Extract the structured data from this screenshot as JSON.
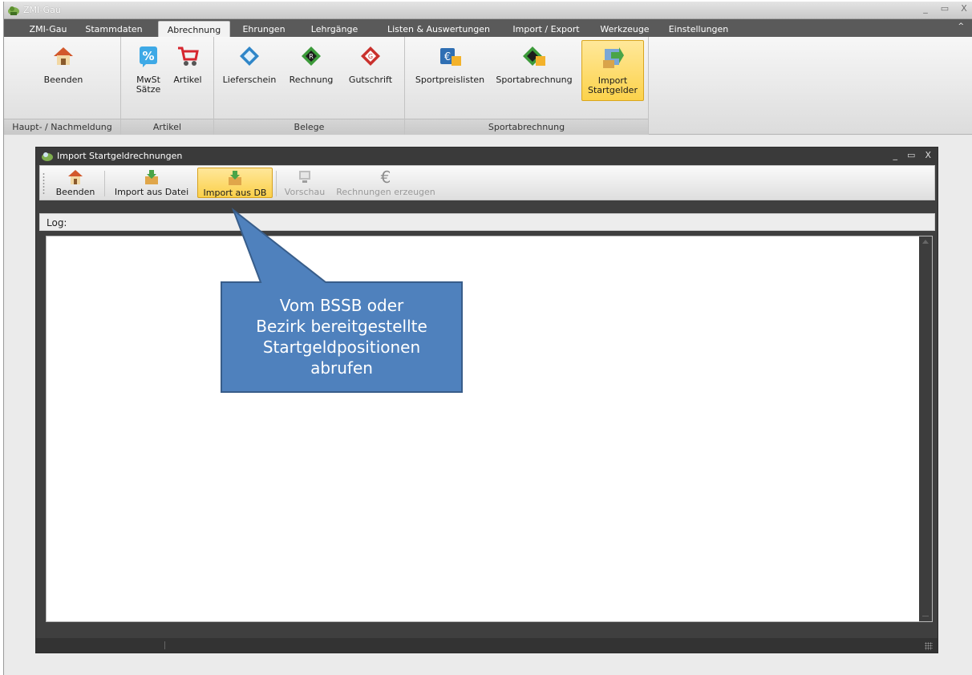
{
  "app": {
    "title": "ZMI-Gau",
    "window_controls": [
      "_",
      "▭",
      "X"
    ]
  },
  "menu": {
    "tabs": [
      {
        "label": "ZMI-Gau"
      },
      {
        "label": "Stammdaten"
      },
      {
        "label": "Abrechnung"
      },
      {
        "label": "Ehrungen"
      },
      {
        "label": "Lehrgänge"
      },
      {
        "label": "Listen & Auswertungen"
      },
      {
        "label": "Import / Export"
      },
      {
        "label": "Werkzeuge"
      },
      {
        "label": "Einstellungen"
      }
    ],
    "active_tab": "Abrechnung",
    "collapse_glyph": "^"
  },
  "ribbon": {
    "groups": [
      {
        "caption": "Haupt- / Nachmeldung",
        "buttons": [
          {
            "label": "Beenden",
            "icon": "house-icon"
          }
        ]
      },
      {
        "caption": "Artikel",
        "buttons": [
          {
            "label": "MwSt Sätze",
            "icon": "percent-icon"
          },
          {
            "label": "Artikel",
            "icon": "cart-icon"
          }
        ]
      },
      {
        "caption": "Belege",
        "buttons": [
          {
            "label": "Lieferschein",
            "icon": "delivery-note-icon"
          },
          {
            "label": "Rechnung",
            "icon": "invoice-icon"
          },
          {
            "label": "Gutschrift",
            "icon": "credit-note-icon"
          }
        ]
      },
      {
        "caption": "Sportabrechnung",
        "buttons": [
          {
            "label": "Sportpreislisten",
            "icon": "euro-list-icon"
          },
          {
            "label": "Sportabrechnung",
            "icon": "sport-invoice-icon"
          },
          {
            "label": "Import Startgelder",
            "icon": "import-fees-icon",
            "active": true
          }
        ]
      }
    ]
  },
  "child_window": {
    "title": "Import Startgeldrechnungen",
    "controls": [
      "_",
      "▭",
      "X"
    ],
    "toolbar": [
      {
        "label": "Beenden",
        "icon": "house-icon",
        "enabled": true
      },
      {
        "label": "Import aus Datei",
        "icon": "import-box-icon",
        "enabled": true
      },
      {
        "label": "Import aus DB",
        "icon": "import-box-icon",
        "enabled": true,
        "active": true
      },
      {
        "label": "Vorschau",
        "icon": "monitor-icon",
        "enabled": false
      },
      {
        "label": "Rechnungen erzeugen",
        "icon": "euro-icon",
        "enabled": false
      }
    ],
    "log_label": "Log:"
  },
  "callout": {
    "lines": [
      "Vom BSSB oder",
      "Bezirk bereitgestellte",
      "Startgeldpositionen",
      "abrufen"
    ],
    "fill": "#4f81bd",
    "stroke": "#385d8a"
  }
}
